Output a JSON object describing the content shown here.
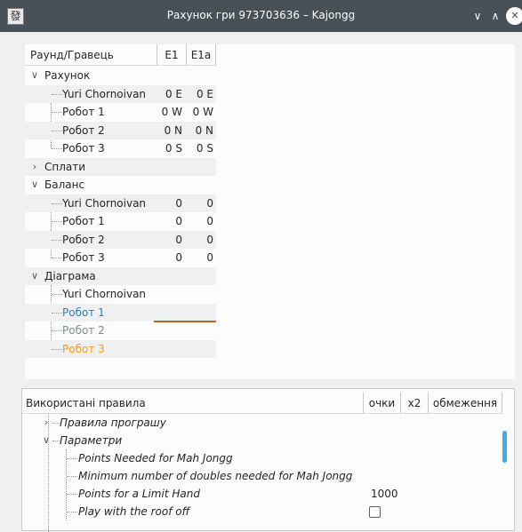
{
  "window": {
    "title": "Рахунок гри 973703636 – Kajongg",
    "icon_glyph": "發",
    "minimize_glyph": "∨",
    "maximize_glyph": "∧",
    "close_glyph": "✕"
  },
  "scores": {
    "headers": {
      "round_player": "Раунд/Гравець",
      "col1": "E1",
      "col2": "E1a"
    },
    "sections": [
      {
        "label": "Рахунок",
        "expanded": true,
        "rows": [
          {
            "name": "Yuri Chornoivan",
            "c1": "0 E",
            "c2": "0 E"
          },
          {
            "name": "Робот 1",
            "c1": "0 W",
            "c2": "0 W"
          },
          {
            "name": "Робот 2",
            "c1": "0 N",
            "c2": "0 N"
          },
          {
            "name": "Робот 3",
            "c1": "0 S",
            "c2": "0 S"
          }
        ]
      },
      {
        "label": "Сплати",
        "expanded": false,
        "rows": []
      },
      {
        "label": "Баланс",
        "expanded": true,
        "rows": [
          {
            "name": "Yuri Chornoivan",
            "c1": "0",
            "c2": "0"
          },
          {
            "name": "Робот 1",
            "c1": "0",
            "c2": "0"
          },
          {
            "name": "Робот 2",
            "c1": "0",
            "c2": "0"
          },
          {
            "name": "Робот 3",
            "c1": "0",
            "c2": "0"
          }
        ]
      },
      {
        "label": "Діаграма",
        "expanded": true,
        "rows": [
          {
            "name": "Yuri Chornoivan",
            "color": "#232627"
          },
          {
            "name": "Робот 1",
            "color": "#2980b9"
          },
          {
            "name": "Робот 2",
            "color": "#7f8c8d"
          },
          {
            "name": "Робот 3",
            "color": "#f39c1f"
          }
        ]
      }
    ]
  },
  "rules": {
    "headers": {
      "rules": "Використані правила",
      "points": "очки",
      "x2": "x2",
      "limits": "обмеження"
    },
    "items": [
      {
        "label": "Правила програшу",
        "level": 1,
        "expander": "closed"
      },
      {
        "label": "Параметри",
        "level": 1,
        "expander": "open"
      },
      {
        "label": "Points Needed for Mah Jongg",
        "level": 2
      },
      {
        "label": "Minimum number of doubles needed for Mah Jongg",
        "level": 2
      },
      {
        "label": "Points for a Limit Hand",
        "level": 2,
        "points": "1000"
      },
      {
        "label": "Play with the roof off",
        "level": 2,
        "checkbox": true,
        "checked": false
      }
    ]
  }
}
